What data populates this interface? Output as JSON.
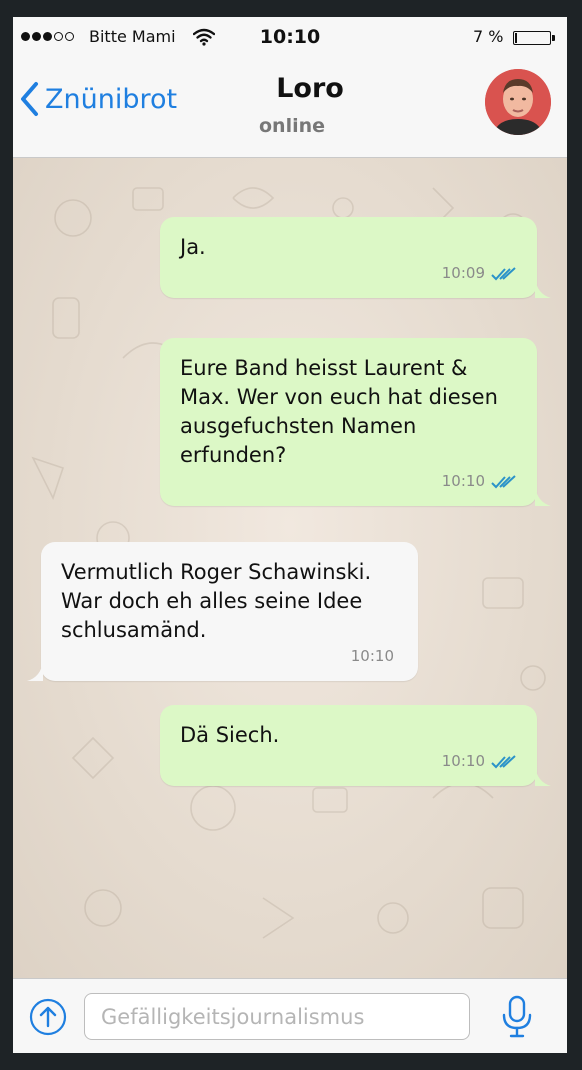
{
  "status_bar": {
    "carrier": "Bitte Mami",
    "time": "10:10",
    "battery_percent": "7 %",
    "battery_level": 0.07,
    "signal_bars_filled": 3,
    "signal_bars_total": 5
  },
  "header": {
    "back_label": "Znünibrot",
    "contact_name": "Loro",
    "contact_status": "online"
  },
  "messages": [
    {
      "direction": "out",
      "lines": [
        "Ja."
      ],
      "time": "10:09",
      "read": true
    },
    {
      "direction": "out",
      "lines": [
        "Eure Band heisst Laurent &",
        "Max. Wer von euch hat diesen",
        "ausgefuchsten Namen",
        "erfunden?"
      ],
      "time": "10:10",
      "read": true
    },
    {
      "direction": "in",
      "lines": [
        "Vermutlich Roger Schawinski.",
        "War doch eh alles seine Idee",
        "schlusamänd."
      ],
      "time": "10:10",
      "read": false
    },
    {
      "direction": "out",
      "lines": [
        "Dä Siech."
      ],
      "time": "10:10",
      "read": true
    }
  ],
  "input": {
    "placeholder": "Gefälligkeitsjournalismus",
    "value": ""
  },
  "colors": {
    "accent": "#1f7fe0",
    "outgoing_bubble": "#dcf8c6",
    "incoming_bubble": "#f7f7f7",
    "read_ticks": "#2b93c9"
  },
  "icons": {
    "back": "chevron-left-icon",
    "wifi": "wifi-icon",
    "battery": "battery-icon",
    "read_receipt": "double-check-icon",
    "upload": "arrow-up-circle-icon",
    "microphone": "microphone-icon"
  }
}
